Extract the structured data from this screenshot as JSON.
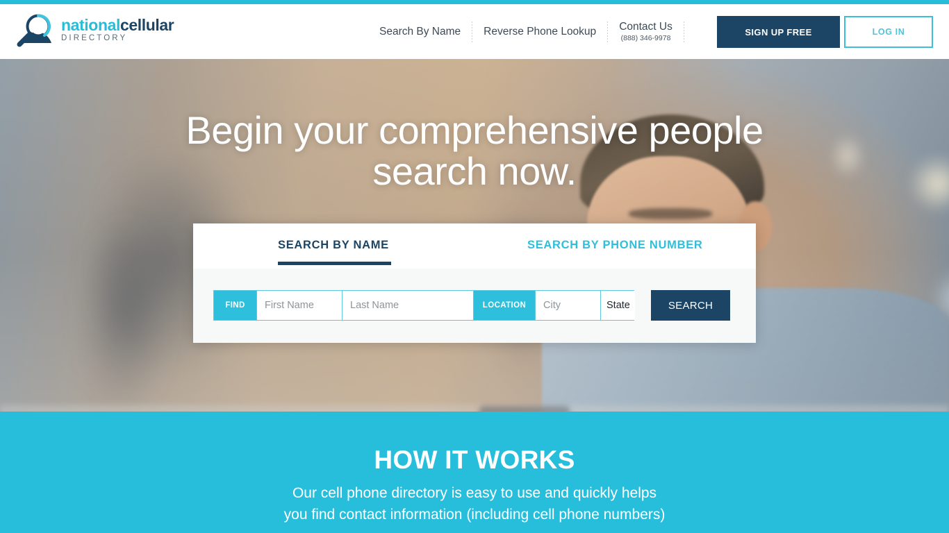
{
  "theme": {
    "cyan": "#27bdd8",
    "navy": "#1b4465",
    "section_cyan": "#27bedc",
    "tab_active_color": "#1b4465",
    "tab_inactive_color": "#2dbfdb"
  },
  "header": {
    "logo": {
      "icon": "magnifying-glass-person-logo",
      "text_primary_1": "national",
      "text_primary_2": "cellular",
      "text_secondary": "DIRECTORY"
    },
    "nav": [
      {
        "label": "Search By Name"
      },
      {
        "label": "Reverse Phone Lookup"
      }
    ],
    "contact": {
      "label": "Contact Us",
      "phone": "(888) 346-9978"
    },
    "signup_label": "SIGN UP FREE",
    "login_label": "LOG IN"
  },
  "hero": {
    "title_line1": "Begin your comprehensive people",
    "title_line2": "search now."
  },
  "search_card": {
    "tabs": [
      {
        "label": "SEARCH BY NAME",
        "active": true
      },
      {
        "label": "SEARCH BY PHONE NUMBER",
        "active": false
      }
    ],
    "find_tag": "FIND",
    "location_tag": "LOCATION",
    "fields": {
      "first_name": {
        "placeholder": "First Name",
        "value": ""
      },
      "last_name": {
        "placeholder": "Last Name",
        "value": ""
      },
      "city": {
        "placeholder": "City",
        "value": ""
      },
      "state": {
        "selected": "State"
      }
    },
    "search_button": "SEARCH"
  },
  "how_it_works": {
    "title": "HOW IT WORKS",
    "subtitle": "Our cell phone directory is easy to use and quickly helps you find contact information (including cell phone numbers)"
  }
}
